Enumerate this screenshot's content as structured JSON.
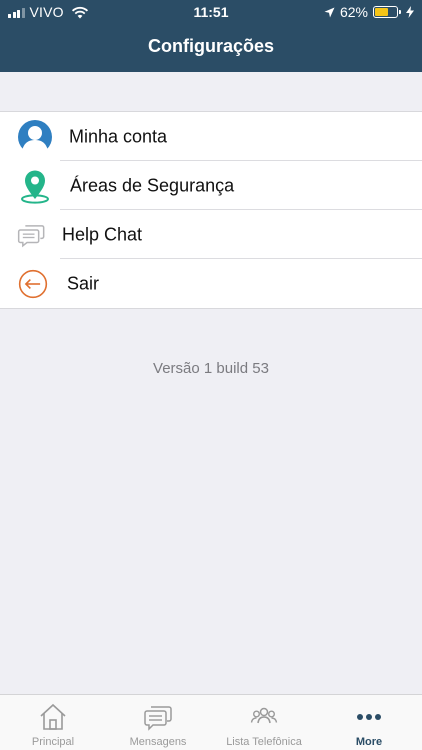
{
  "status_bar": {
    "carrier": "VIVO",
    "time": "11:51",
    "battery_percent": "62%",
    "battery_level": 0.62
  },
  "nav": {
    "title": "Configurações"
  },
  "menu": {
    "items": [
      {
        "label": "Minha conta",
        "icon": "user-avatar-icon"
      },
      {
        "label": "Áreas de Segurança",
        "icon": "location-pin-icon"
      },
      {
        "label": "Help Chat",
        "icon": "chat-bubbles-icon"
      },
      {
        "label": "Sair",
        "icon": "logout-arrow-icon"
      }
    ]
  },
  "version_text": "Versão 1 build 53",
  "tabbar": {
    "tabs": [
      {
        "label": "Principal",
        "icon": "home-icon",
        "active": false
      },
      {
        "label": "Mensagens",
        "icon": "messages-icon",
        "active": false
      },
      {
        "label": "Lista Telefônica",
        "icon": "contacts-group-icon",
        "active": false
      },
      {
        "label": "More",
        "icon": "more-dots-icon",
        "active": true
      }
    ]
  },
  "colors": {
    "header": "#2b4d66",
    "avatar_blue": "#2f7fc1",
    "pin_green": "#24b58a",
    "logout_orange": "#e07030",
    "battery": "#f5c518"
  }
}
